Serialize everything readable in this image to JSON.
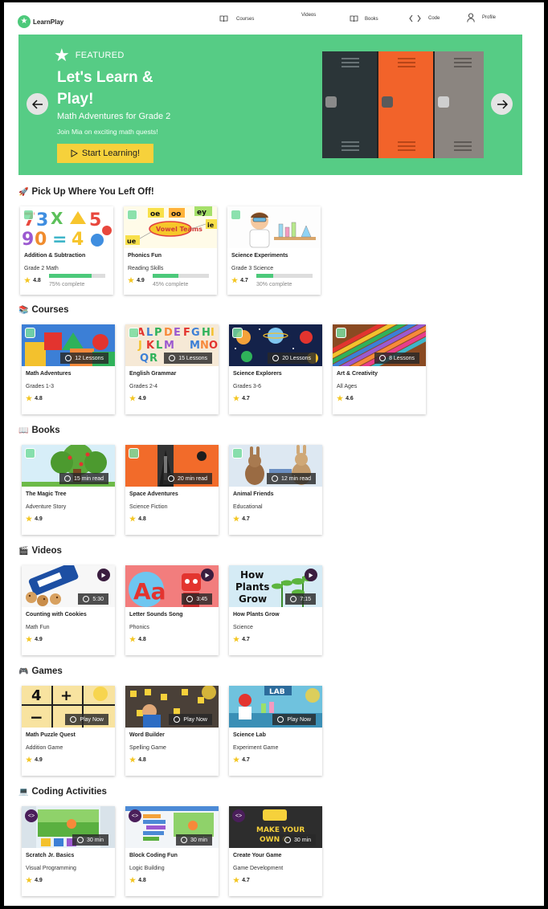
{
  "app": {
    "name": "LearnPlay"
  },
  "nav": [
    {
      "label": "Courses",
      "icon": "book-icon"
    },
    {
      "label": "Videos",
      "icon": ""
    },
    {
      "label": "Books",
      "icon": "book-icon"
    },
    {
      "label": "Code",
      "icon": "code-icon"
    },
    {
      "label": "Profile",
      "icon": "user-icon"
    }
  ],
  "hero": {
    "badge": "FEATURED",
    "title": "Let's Learn & Play!",
    "subtitle": "Math Adventures for Grade 2",
    "description": "Join Mia on exciting math quests!",
    "button": "Start Learning!",
    "accent": "#56cc85",
    "button_color": "#f6d13b"
  },
  "sections": {
    "continue": {
      "title": "Pick Up Where You Left Off!",
      "emoji": "🚀",
      "items": [
        {
          "title": "Addition & Subtraction",
          "sub": "Grade 2 Math",
          "rating": "4.8",
          "progress": 0.75,
          "progress_text": "75% complete"
        },
        {
          "title": "Phonics Fun",
          "sub": "Reading Skills",
          "rating": "4.9",
          "progress": 0.45,
          "progress_text": "45% complete"
        },
        {
          "title": "Science Experiments",
          "sub": "Grade 3 Science",
          "rating": "4.7",
          "progress": 0.3,
          "progress_text": "30% complete"
        }
      ]
    },
    "courses": {
      "title": "Courses",
      "emoji": "📚",
      "items": [
        {
          "title": "Math Adventures",
          "sub": "Grades 1-3",
          "rating": "4.8",
          "pill": "12 Lessons"
        },
        {
          "title": "English Grammar",
          "sub": "Grades 2-4",
          "rating": "4.9",
          "pill": "15 Lessons"
        },
        {
          "title": "Science Explorers",
          "sub": "Grades 3-6",
          "rating": "4.7",
          "pill": "20 Lessons"
        },
        {
          "title": "Art & Creativity",
          "sub": "All Ages",
          "rating": "4.6",
          "pill": "8 Lessons"
        }
      ]
    },
    "books": {
      "title": "Books",
      "emoji": "📖",
      "items": [
        {
          "title": "The Magic Tree",
          "sub": "Adventure Story",
          "rating": "4.9",
          "pill": "15 min read"
        },
        {
          "title": "Space Adventures",
          "sub": "Science Fiction",
          "rating": "4.8",
          "pill": "20 min read"
        },
        {
          "title": "Animal Friends",
          "sub": "Educational",
          "rating": "4.7",
          "pill": "12 min read"
        }
      ]
    },
    "videos": {
      "title": "Videos",
      "emoji": "🎬",
      "items": [
        {
          "title": "Counting with Cookies",
          "sub": "Math Fun",
          "rating": "4.9",
          "pill": "5:30"
        },
        {
          "title": "Letter Sounds Song",
          "sub": "Phonics",
          "rating": "4.8",
          "pill": "3:45"
        },
        {
          "title": "How Plants Grow",
          "sub": "Science",
          "rating": "4.7",
          "pill": "7:15"
        }
      ]
    },
    "games": {
      "title": "Games",
      "emoji": "🎮",
      "items": [
        {
          "title": "Math Puzzle Quest",
          "sub": "Addition Game",
          "rating": "4.9",
          "pill": "Play Now"
        },
        {
          "title": "Word Builder",
          "sub": "Spelling Game",
          "rating": "4.8",
          "pill": "Play Now"
        },
        {
          "title": "Science Lab",
          "sub": "Experiment Game",
          "rating": "4.7",
          "pill": "Play Now"
        }
      ]
    },
    "coding": {
      "title": "Coding Activities",
      "emoji": "💻",
      "items": [
        {
          "title": "Scratch Jr. Basics",
          "sub": "Visual Programming",
          "rating": "4.9",
          "pill": "30 min"
        },
        {
          "title": "Block Coding Fun",
          "sub": "Logic Building",
          "rating": "4.8",
          "pill": "30 min"
        },
        {
          "title": "Create Your Game",
          "sub": "Game Development",
          "rating": "4.7",
          "pill": "30 min"
        }
      ]
    }
  },
  "thumb_art": {
    "addition": [
      "7",
      "3",
      "X",
      "5",
      "9",
      "0",
      "=",
      "4"
    ],
    "phonics": [
      "oe",
      "oo",
      "ey",
      "ie",
      "ue",
      "Vowel Teams"
    ],
    "letters": "ALPDEFGHIJKLMNOP",
    "video_letters": "Aa",
    "video_plants": [
      "How",
      "Plants",
      "Grow"
    ],
    "games_math": [
      "4",
      "+",
      "−"
    ],
    "games_lab": "LAB",
    "coding_game": "MAKE YOUR OWN"
  }
}
